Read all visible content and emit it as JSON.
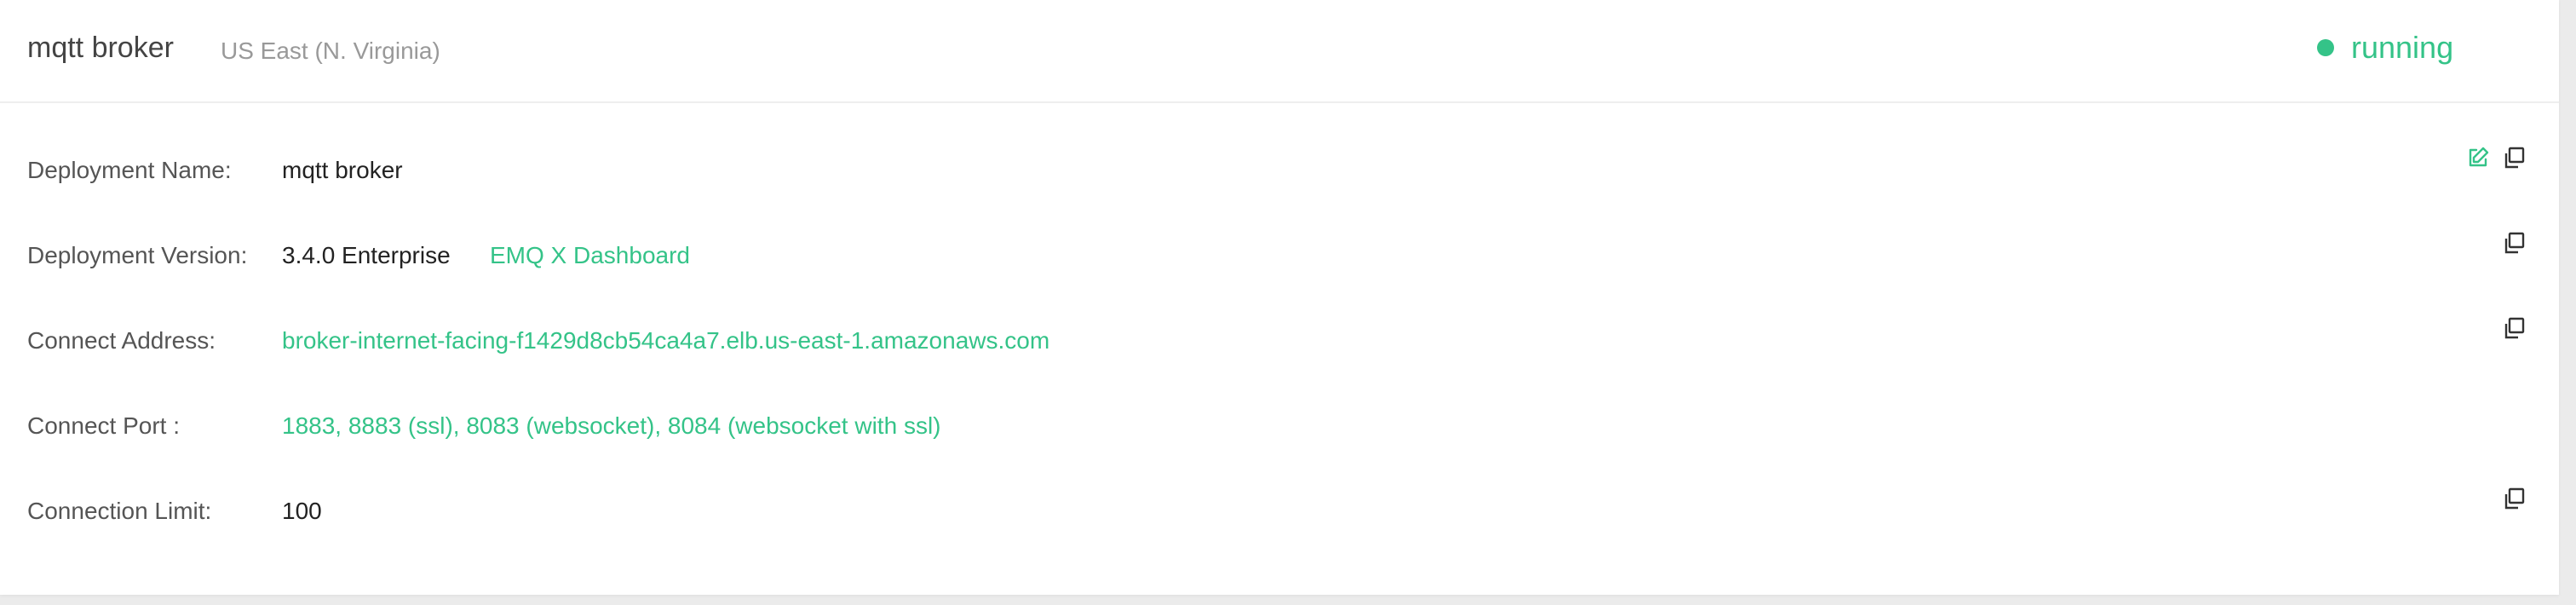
{
  "header": {
    "title": "mqtt broker",
    "region": "US East (N. Virginia)",
    "status": "running"
  },
  "details": {
    "deployment_name": {
      "label": "Deployment Name:",
      "value": "mqtt broker"
    },
    "deployment_version": {
      "label": "Deployment Version:",
      "value": "3.4.0 Enterprise",
      "dashboard_link": "EMQ X Dashboard"
    },
    "connect_address": {
      "label": "Connect Address:",
      "value": "broker-internet-facing-f1429d8cb54ca4a7.elb.us-east-1.amazonaws.com"
    },
    "connect_port": {
      "label": "Connect Port :",
      "value": "1883, 8883 (ssl), 8083 (websocket), 8084 (websocket with ssl)"
    },
    "connection_limit": {
      "label": "Connection Limit:",
      "value": "100"
    }
  },
  "icons": {
    "edit": "edit-icon",
    "copy": "copy-icon"
  },
  "colors": {
    "accent": "#34c388",
    "label": "#555555",
    "value": "#222222",
    "muted": "#999999",
    "page_background": "#ebebeb"
  }
}
